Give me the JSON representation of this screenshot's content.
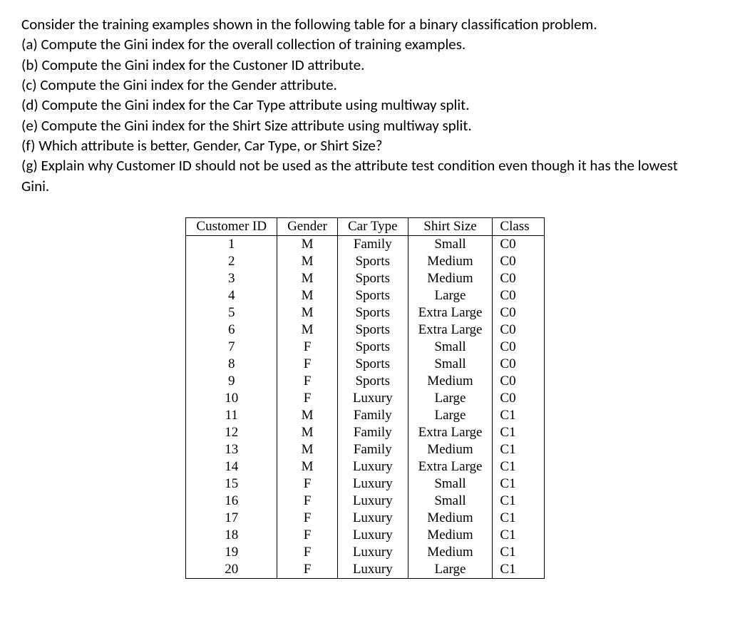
{
  "intro": "Consider the training examples shown in the following table for a binary classification problem.",
  "parts": {
    "a": "(a) Compute the Gini index for the overall collection of training examples.",
    "b": "(b) Compute the Gini index for the Custoner ID attribute.",
    "c": "(c) Compute the Gini index for the Gender attribute.",
    "d": "(d) Compute the Gini index for the Car Type attribute using multiway split.",
    "e": "(e) Compute the Gini index for the Shirt Size attribute using multiway split.",
    "f": "(f) Which attribute is better, Gender, Car Type, or Shirt Size?",
    "g": "(g) Explain why Customer ID should not be used as the attribute test condition even though it has the lowest Gini."
  },
  "table": {
    "headers": [
      "Customer ID",
      "Gender",
      "Car Type",
      "Shirt Size",
      "Class"
    ],
    "rows": [
      {
        "id": "1",
        "gender": "M",
        "car": "Family",
        "shirt": "Small",
        "class": "C0"
      },
      {
        "id": "2",
        "gender": "M",
        "car": "Sports",
        "shirt": "Medium",
        "class": "C0"
      },
      {
        "id": "3",
        "gender": "M",
        "car": "Sports",
        "shirt": "Medium",
        "class": "C0"
      },
      {
        "id": "4",
        "gender": "M",
        "car": "Sports",
        "shirt": "Large",
        "class": "C0"
      },
      {
        "id": "5",
        "gender": "M",
        "car": "Sports",
        "shirt": "Extra Large",
        "class": "C0"
      },
      {
        "id": "6",
        "gender": "M",
        "car": "Sports",
        "shirt": "Extra Large",
        "class": "C0"
      },
      {
        "id": "7",
        "gender": "F",
        "car": "Sports",
        "shirt": "Small",
        "class": "C0"
      },
      {
        "id": "8",
        "gender": "F",
        "car": "Sports",
        "shirt": "Small",
        "class": "C0"
      },
      {
        "id": "9",
        "gender": "F",
        "car": "Sports",
        "shirt": "Medium",
        "class": "C0"
      },
      {
        "id": "10",
        "gender": "F",
        "car": "Luxury",
        "shirt": "Large",
        "class": "C0"
      },
      {
        "id": "11",
        "gender": "M",
        "car": "Family",
        "shirt": "Large",
        "class": "C1"
      },
      {
        "id": "12",
        "gender": "M",
        "car": "Family",
        "shirt": "Extra Large",
        "class": "C1"
      },
      {
        "id": "13",
        "gender": "M",
        "car": "Family",
        "shirt": "Medium",
        "class": "C1"
      },
      {
        "id": "14",
        "gender": "M",
        "car": "Luxury",
        "shirt": "Extra Large",
        "class": "C1"
      },
      {
        "id": "15",
        "gender": "F",
        "car": "Luxury",
        "shirt": "Small",
        "class": "C1"
      },
      {
        "id": "16",
        "gender": "F",
        "car": "Luxury",
        "shirt": "Small",
        "class": "C1"
      },
      {
        "id": "17",
        "gender": "F",
        "car": "Luxury",
        "shirt": "Medium",
        "class": "C1"
      },
      {
        "id": "18",
        "gender": "F",
        "car": "Luxury",
        "shirt": "Medium",
        "class": "C1"
      },
      {
        "id": "19",
        "gender": "F",
        "car": "Luxury",
        "shirt": "Medium",
        "class": "C1"
      },
      {
        "id": "20",
        "gender": "F",
        "car": "Luxury",
        "shirt": "Large",
        "class": "C1"
      }
    ]
  }
}
